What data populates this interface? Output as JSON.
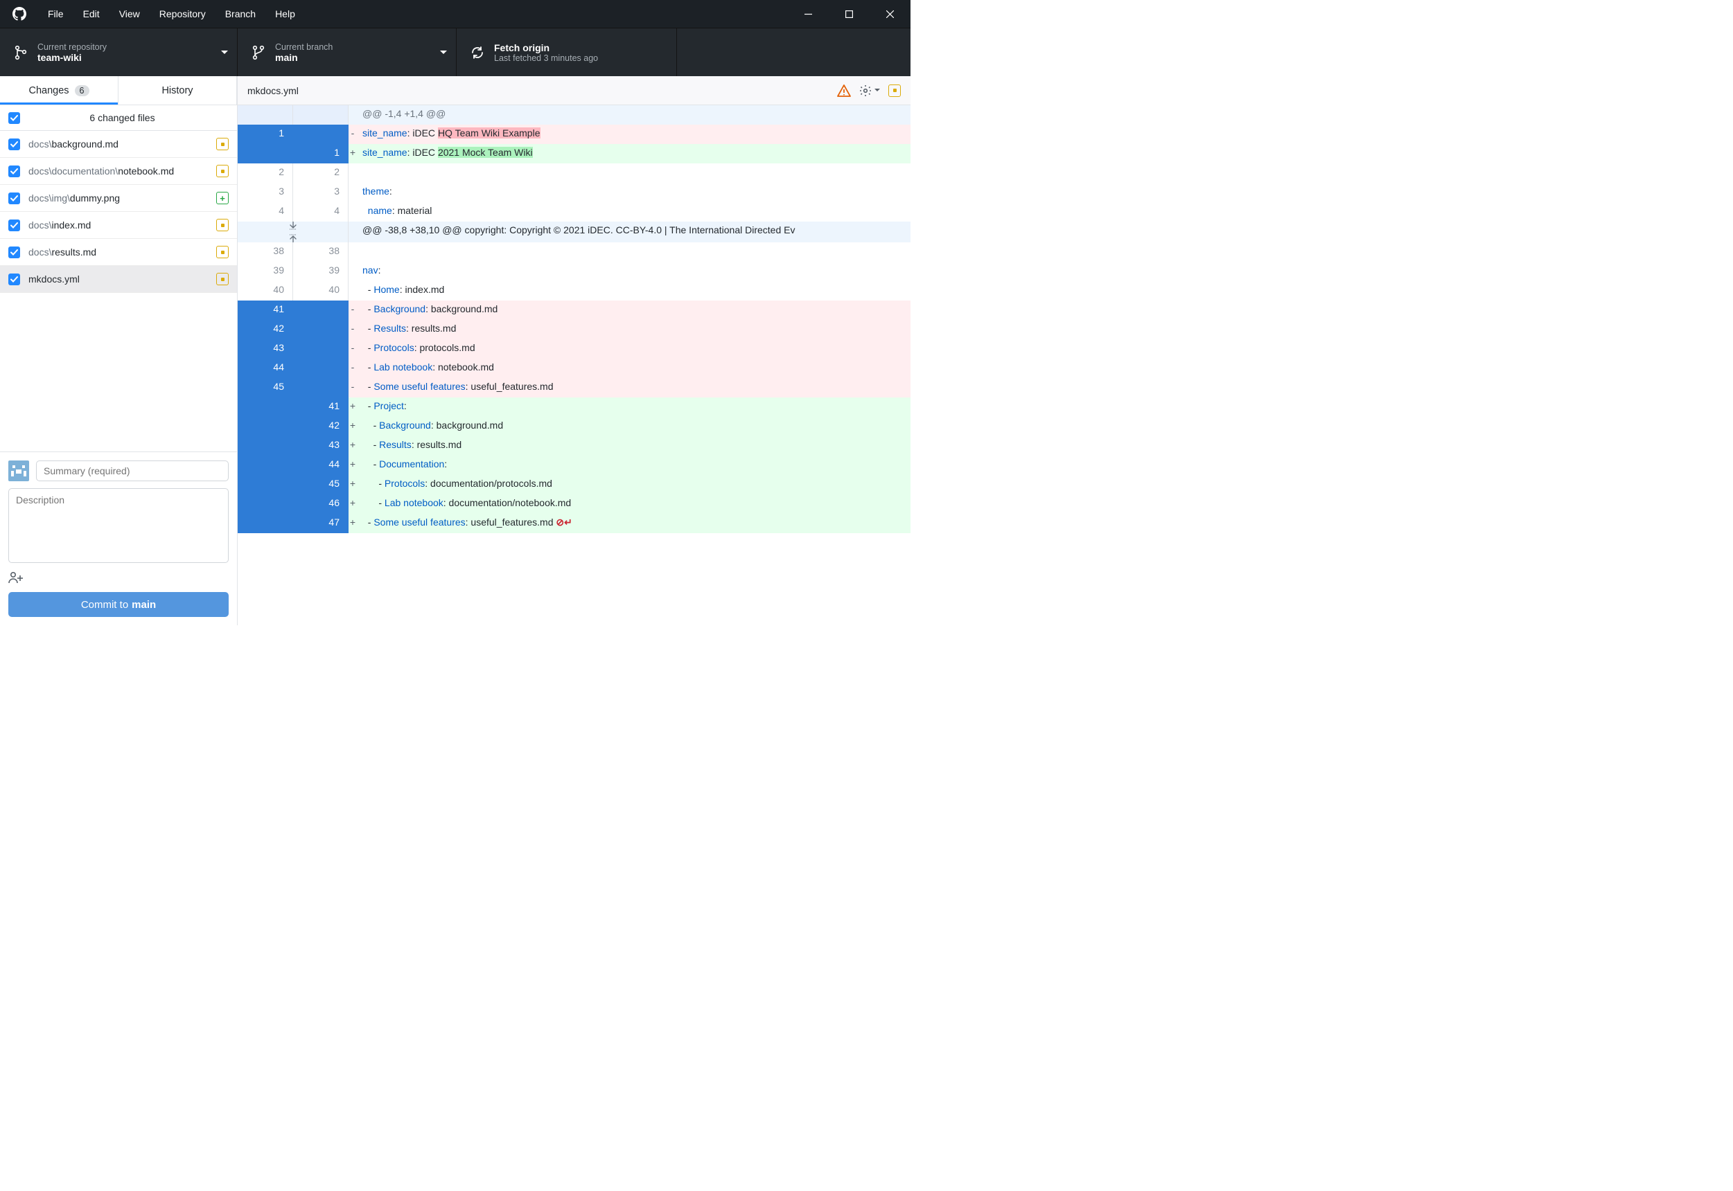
{
  "menu": {
    "items": [
      "File",
      "Edit",
      "View",
      "Repository",
      "Branch",
      "Help"
    ]
  },
  "toolbar": {
    "repo": {
      "label": "Current repository",
      "value": "team-wiki"
    },
    "branch": {
      "label": "Current branch",
      "value": "main"
    },
    "fetch": {
      "label": "Fetch origin",
      "value": "Last fetched 3 minutes ago"
    }
  },
  "tabs": {
    "changes": {
      "label": "Changes",
      "badge": "6"
    },
    "history": {
      "label": "History"
    }
  },
  "changes_header": "6 changed files",
  "files": [
    {
      "prefix": "docs\\",
      "name": "background.md",
      "status": "mod",
      "selected": false
    },
    {
      "prefix": "docs\\documentation\\",
      "name": "notebook.md",
      "status": "mod",
      "selected": false
    },
    {
      "prefix": "docs\\img\\",
      "name": "dummy.png",
      "status": "add",
      "selected": false
    },
    {
      "prefix": "docs\\",
      "name": "index.md",
      "status": "mod",
      "selected": false
    },
    {
      "prefix": "docs\\",
      "name": "results.md",
      "status": "mod",
      "selected": false
    },
    {
      "prefix": "",
      "name": "mkdocs.yml",
      "status": "mod",
      "selected": true
    }
  ],
  "commit": {
    "summary_placeholder": "Summary (required)",
    "description_placeholder": "Description",
    "button_prefix": "Commit to ",
    "button_branch": "main"
  },
  "filebar": {
    "name": "mkdocs.yml"
  },
  "diff": {
    "rows": [
      {
        "type": "hunk",
        "text": "@@ -1,4 +1,4 @@"
      },
      {
        "type": "del",
        "old": "1",
        "new": "",
        "segments": [
          {
            "t": "key",
            "v": "site_name"
          },
          {
            "t": "plain",
            "v": ": iDEC "
          },
          {
            "t": "hl",
            "v": "HQ Team Wiki Example"
          }
        ]
      },
      {
        "type": "add",
        "old": "",
        "new": "1",
        "segments": [
          {
            "t": "key",
            "v": "site_name"
          },
          {
            "t": "plain",
            "v": ": iDEC "
          },
          {
            "t": "hl",
            "v": "2021 Mock Team Wiki"
          }
        ]
      },
      {
        "type": "context",
        "old": "2",
        "new": "2",
        "segments": [
          {
            "t": "plain",
            "v": ""
          }
        ]
      },
      {
        "type": "context",
        "old": "3",
        "new": "3",
        "segments": [
          {
            "t": "key",
            "v": "theme"
          },
          {
            "t": "plain",
            "v": ":"
          }
        ]
      },
      {
        "type": "context",
        "old": "4",
        "new": "4",
        "segments": [
          {
            "t": "plain",
            "v": "  "
          },
          {
            "t": "key",
            "v": "name"
          },
          {
            "t": "plain",
            "v": ": material"
          }
        ]
      },
      {
        "type": "expand",
        "text": "@@ -38,8 +38,10 @@ copyright: Copyright &copy; 2021 iDEC. CC-BY-4.0 | The International Directed Ev"
      },
      {
        "type": "context",
        "old": "38",
        "new": "38",
        "segments": [
          {
            "t": "plain",
            "v": ""
          }
        ]
      },
      {
        "type": "context",
        "old": "39",
        "new": "39",
        "segments": [
          {
            "t": "key",
            "v": "nav"
          },
          {
            "t": "plain",
            "v": ":"
          }
        ]
      },
      {
        "type": "context",
        "old": "40",
        "new": "40",
        "segments": [
          {
            "t": "plain",
            "v": "  - "
          },
          {
            "t": "key",
            "v": "Home"
          },
          {
            "t": "plain",
            "v": ": index.md"
          }
        ]
      },
      {
        "type": "del",
        "old": "41",
        "new": "",
        "segments": [
          {
            "t": "plain",
            "v": "  - "
          },
          {
            "t": "key",
            "v": "Background"
          },
          {
            "t": "plain",
            "v": ": background.md"
          }
        ]
      },
      {
        "type": "del",
        "old": "42",
        "new": "",
        "segments": [
          {
            "t": "plain",
            "v": "  - "
          },
          {
            "t": "key",
            "v": "Results"
          },
          {
            "t": "plain",
            "v": ": results.md"
          }
        ]
      },
      {
        "type": "del",
        "old": "43",
        "new": "",
        "segments": [
          {
            "t": "plain",
            "v": "  - "
          },
          {
            "t": "key",
            "v": "Protocols"
          },
          {
            "t": "plain",
            "v": ": protocols.md"
          }
        ]
      },
      {
        "type": "del",
        "old": "44",
        "new": "",
        "segments": [
          {
            "t": "plain",
            "v": "  - "
          },
          {
            "t": "key",
            "v": "Lab notebook"
          },
          {
            "t": "plain",
            "v": ": notebook.md"
          }
        ]
      },
      {
        "type": "del",
        "old": "45",
        "new": "",
        "segments": [
          {
            "t": "plain",
            "v": "  - "
          },
          {
            "t": "key",
            "v": "Some useful features"
          },
          {
            "t": "plain",
            "v": ": useful_features.md"
          }
        ]
      },
      {
        "type": "add",
        "old": "",
        "new": "41",
        "segments": [
          {
            "t": "plain",
            "v": "  - "
          },
          {
            "t": "key",
            "v": "Project"
          },
          {
            "t": "plain",
            "v": ":"
          }
        ]
      },
      {
        "type": "add",
        "old": "",
        "new": "42",
        "segments": [
          {
            "t": "plain",
            "v": "    - "
          },
          {
            "t": "key",
            "v": "Background"
          },
          {
            "t": "plain",
            "v": ": background.md"
          }
        ]
      },
      {
        "type": "add",
        "old": "",
        "new": "43",
        "segments": [
          {
            "t": "plain",
            "v": "    - "
          },
          {
            "t": "key",
            "v": "Results"
          },
          {
            "t": "plain",
            "v": ": results.md"
          }
        ]
      },
      {
        "type": "add",
        "old": "",
        "new": "44",
        "segments": [
          {
            "t": "plain",
            "v": "    - "
          },
          {
            "t": "key",
            "v": "Documentation"
          },
          {
            "t": "plain",
            "v": ":"
          }
        ]
      },
      {
        "type": "add",
        "old": "",
        "new": "45",
        "segments": [
          {
            "t": "plain",
            "v": "      - "
          },
          {
            "t": "key",
            "v": "Protocols"
          },
          {
            "t": "plain",
            "v": ": documentation/protocols.md"
          }
        ]
      },
      {
        "type": "add",
        "old": "",
        "new": "46",
        "segments": [
          {
            "t": "plain",
            "v": "      - "
          },
          {
            "t": "key",
            "v": "Lab notebook"
          },
          {
            "t": "plain",
            "v": ": documentation/notebook.md"
          }
        ]
      },
      {
        "type": "add",
        "old": "",
        "new": "47",
        "segments": [
          {
            "t": "plain",
            "v": "  - "
          },
          {
            "t": "key",
            "v": "Some useful features"
          },
          {
            "t": "plain",
            "v": ": useful_features.md"
          }
        ],
        "nonewline": true
      }
    ]
  }
}
